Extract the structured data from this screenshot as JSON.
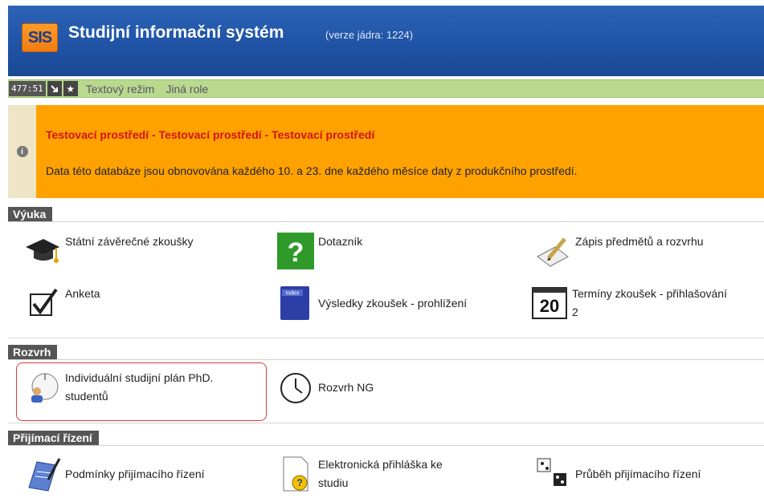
{
  "header": {
    "logo": "SIS",
    "title": "Studijní informační systém",
    "version": "(verze jádra: 1224)"
  },
  "toolbar": {
    "timer": "477:51",
    "links": [
      "Textový režim",
      "Jiná role"
    ]
  },
  "notice": {
    "title": "Testovací prostředí - Testovací prostředí - Testovací prostředí",
    "text": "Data této databáze jsou obnovována každého 10. a 23. dne každého měsíce daty z produkčního prostředí."
  },
  "sections": {
    "vyuka": {
      "title": "Výuka",
      "items": [
        {
          "label": "Státní závěrečné zkoušky",
          "icon": "graduation-cap-icon"
        },
        {
          "label": "Dotazník",
          "icon": "question-mark-icon"
        },
        {
          "label": "Zápis předmětů a rozvrhu",
          "icon": "pencil-notepad-icon"
        },
        {
          "label": "Anketa",
          "icon": "checkbox-icon"
        },
        {
          "label": "Výsledky zkoušek - prohlížení",
          "icon": "index-book-icon"
        },
        {
          "label": "Termíny zkoušek - přihlašování",
          "label2": "2",
          "icon": "calendar-20-icon"
        }
      ]
    },
    "rozvrh": {
      "title": "Rozvrh",
      "items": [
        {
          "label": "Individuální studijní plán PhD.",
          "label2": "studentů",
          "icon": "student-plan-icon"
        },
        {
          "label": "Rozvrh NG",
          "icon": "clock-icon"
        }
      ]
    },
    "prijimaci": {
      "title": "Přijímací řízení",
      "items": [
        {
          "label": "Podmínky přijímacího řízení",
          "icon": "clipboard-pen-icon"
        },
        {
          "label": "Elektronická přihláška ke",
          "label2": "studiu",
          "icon": "document-question-icon"
        },
        {
          "label": "Průběh přijímacího řízení",
          "icon": "dice-icon"
        }
      ]
    }
  }
}
